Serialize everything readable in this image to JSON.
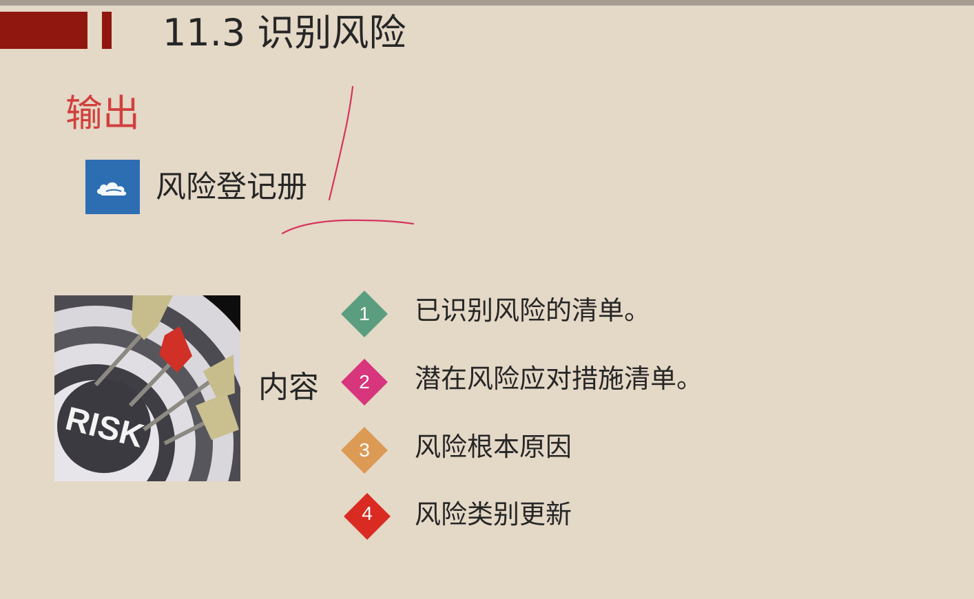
{
  "slide": {
    "title": "11.3 识别风险",
    "section_title": "输出",
    "register": {
      "icon": "cloud-icon",
      "label": "风险登记册"
    },
    "content_label": "内容",
    "risk_image": {
      "text": "RISK"
    },
    "items": [
      {
        "number": "1",
        "text": "已识别风险的清单。",
        "color": "#5a9e7f"
      },
      {
        "number": "2",
        "text": "潜在风险应对措施清单。",
        "color": "#d7367d"
      },
      {
        "number": "3",
        "text": "风险根本原因",
        "color": "#dc9a55"
      },
      {
        "number": "4",
        "text": "风险类别更新",
        "color": "#d92b22"
      }
    ]
  },
  "colors": {
    "background": "#e4d8c7",
    "accent": "#901710",
    "section_title": "#d1403d",
    "icon_blue": "#2d6eb3",
    "annotation_ink": "#d5345c"
  }
}
